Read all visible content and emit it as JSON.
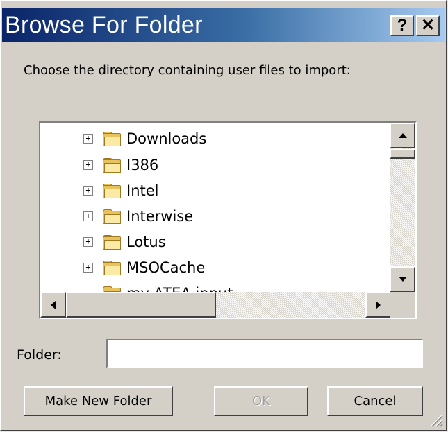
{
  "window": {
    "title": "Browse For Folder",
    "help_label": "?",
    "close_label": "✕"
  },
  "instruction": "Choose the directory containing user files to import:",
  "tree": {
    "items": [
      {
        "label": "Downloads",
        "expander": "+"
      },
      {
        "label": "I386",
        "expander": "+"
      },
      {
        "label": "Intel",
        "expander": "+"
      },
      {
        "label": "Interwise",
        "expander": "+"
      },
      {
        "label": "Lotus",
        "expander": "+"
      },
      {
        "label": "MSOCache",
        "expander": "+"
      },
      {
        "label": "my ATEA input",
        "expander": ""
      }
    ]
  },
  "folder_field": {
    "label": "Folder:",
    "value": ""
  },
  "buttons": {
    "make_new_folder": "Make New Folder",
    "ok": "OK",
    "cancel": "Cancel"
  },
  "colors": {
    "title_start": "#0a246a",
    "title_end": "#a6caf0",
    "face": "#d4d0c8",
    "folder": "#e8c25a"
  }
}
